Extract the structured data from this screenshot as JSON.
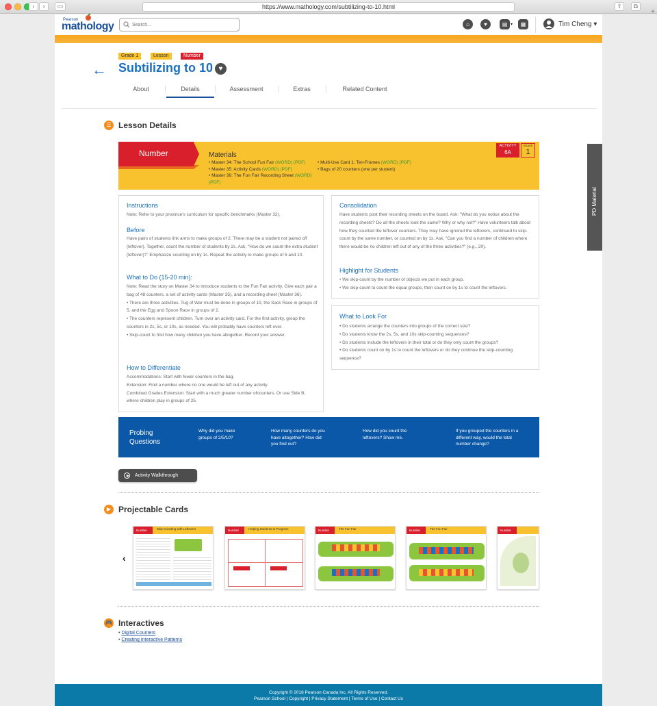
{
  "browser": {
    "url": "https://www.mathology.com/subtilizing-to-10.html"
  },
  "header": {
    "logo_pre": "Pearson",
    "logo_name": "mathology",
    "search_placeholder": "Search...",
    "user_name": "Tim Cheng ▾"
  },
  "lesson": {
    "badges": [
      "Grade 1",
      "Lesson",
      "Number"
    ],
    "title": "Subtilizing to 10"
  },
  "tabs": [
    "About",
    "Details",
    "Assessment",
    "Extras",
    "Related Content"
  ],
  "lesson_details": {
    "section_title": "Lesson Details",
    "strand": "Number",
    "materials_title": "Materials",
    "materials_left": [
      {
        "text": "• Master 34: The School Fun Fair ",
        "links": "(WORD) (PDF)"
      },
      {
        "text": "• Master 35: Activity Cards ",
        "links": "(WORD) (PDF)"
      },
      {
        "text": "• Master 36: The Fun Fair Recording Sheet ",
        "links": "(WORD) (PDF)"
      }
    ],
    "materials_right": [
      {
        "text": "• Multi-Use Card 1: Ten-Frames ",
        "links": "(WORD) (PDF)"
      },
      {
        "text": "• Bags of 20 counters (one per student)",
        "links": ""
      }
    ],
    "activity_label": "ACTIVITY",
    "activity_value": "6A",
    "grade_label": "GRADE",
    "grade_value": "1"
  },
  "instructions": {
    "h_instructions": "Instructions",
    "p_instructions": "Note: Refer to your province's curriculum for specific benchmarks (Master 32).",
    "h_before": "Before",
    "p_before": "Have pairs of students link arms to make groups of 2. There may be a student not paired off (leftover). Together, count the number of students by 2s. Ask, \"How do we count the extra student (leftover)?\" Emphasize counting on by 1s. Repeat the activity to make groups of 5 and 10.",
    "h_whattodo": "What to Do (15-20 min):",
    "p_whattodo": [
      "Note: Read the story on Master 34 to introduce students to the Fun Fair activity. Give each pair a bag of 48 counters, a set of activity cards (Master 35), and a recording sheet (Master 36).",
      "• There are three activities. Tug of War must be done in groups of 10, the Sack Race in groups of 5, and the Egg and Spoon Race in groups of 2.",
      "• The counters represent children. Turn over an activity card. For the first activity, group the counters in 2s, 5s, or 10s, as needed. You will probably have counters left over.",
      "• Skip-count to find how many children you have altogether. Record your answer."
    ],
    "h_differentiate": "How to Differentiate",
    "p_differentiate": [
      "Accommodations: Start with fewer counters in the bag.",
      "Extension: Find a number where no one would be left out of any activity.",
      "Combined Grades Extension: Start with a much greater number ofcounters. Or use Side B, where children play in groups of 25."
    ]
  },
  "consolidation": {
    "h": "Consolidation",
    "p": "Have students post their recording sheets on the board. Ask: \"What do you notice about the recording sheets? Do all the sheets look the same? Why or why not?\" Have volunteers talk about how they counted the leftover counters. They may have ignored the leftovers, continued to skip-count by the same number, or counted on by 1s. Ask, \"Can you find a number of children where there would be no children left out of any of the three activities?\" (e.g., 20).",
    "h2": "Highlight for Students",
    "p2": [
      "• We skip-count by the number of objects we put in each group.",
      "• We skip-count to count the equal groups, then count on by 1s to count the leftovers."
    ]
  },
  "look_for": {
    "h": "What to Look For",
    "items": [
      "• Do students arrange the counters into groups of the correct size?",
      "• Do students know the 2s, 5s, and 10s skip-counting sequences?",
      "• Do students include the leftovers in their total or do they only count the groups?",
      "• Do students count on by 1s to count the leftovers or do they continue the skip-counting sequence?"
    ]
  },
  "probing": {
    "title": "Probing Questions",
    "questions": [
      "Why did you make groups of 2/5/10?",
      "How many counters do you have altogether? How did you find out?",
      "How did you count the leftovers? Show me.",
      "If you grouped the counters in a different way, would the total number change?"
    ]
  },
  "walkthrough_label": "Activity Walkthrough",
  "projectable": {
    "title": "Projectable Cards",
    "cards": [
      {
        "strand": "Number",
        "title": "Skip-Counting with Leftovers"
      },
      {
        "strand": "Number",
        "title": "Helping Students to Progress"
      },
      {
        "strand": "Number",
        "title": "The Fun Fair"
      },
      {
        "strand": "Number",
        "title": "The Fun Fair"
      },
      {
        "strand": "Number",
        "title": ""
      }
    ]
  },
  "interactives": {
    "title": "Interactives",
    "links": [
      "Digital Counters",
      "Creating Interactive Patterns"
    ]
  },
  "footer": {
    "line1": "Copyright © 2018 Pearson Canada Inc. All Rights Reserved.",
    "line2": "Pearson School | Copyright | Privacy Statement | Terms of Use | Contact Us"
  },
  "pd_material": "PD Material",
  "colors": {
    "accent": "#1a6fc0",
    "orange": "#f7a41d",
    "red": "#d91f2b",
    "yellow": "#f8c12e",
    "blue": "#0a58a7",
    "footer": "#0c7aa8"
  }
}
